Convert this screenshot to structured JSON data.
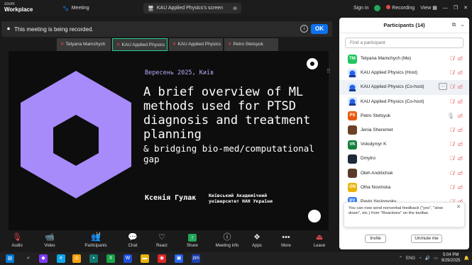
{
  "titlebar": {
    "brand_line1": "zoom",
    "brand_line2": "Workplace",
    "meeting_tab": "Meeting",
    "share_tab": "KAU Applied Physics's screen",
    "signin": "Sign in",
    "recording": "Recording",
    "view": "View"
  },
  "banner": {
    "text": "This meeting is being recorded.",
    "ok": "OK"
  },
  "thumbnails": [
    {
      "name": "Tetyana Mamchych"
    },
    {
      "name": "KAU Applied Physics"
    },
    {
      "name": "KAU Applied Physics"
    },
    {
      "name": "Petro Stetsyuk"
    }
  ],
  "slide": {
    "date": "Вересень 2025, Київ",
    "title": "A brief overview of ML methods used for PTSD diagnosis and treatment planning",
    "subtitle": "& bridging bio-med/computational gap",
    "author": "Ксенія Гулак",
    "institution_line1": "Київський Академічний",
    "institution_line2": "університет НАН України",
    "accent_color": "#a78bfa"
  },
  "toolbar": {
    "audio": "Audio",
    "video": "Video",
    "participants": "Participants",
    "participants_count": "14",
    "chat": "Chat",
    "react": "React",
    "share": "Share",
    "meeting_info": "Meeting info",
    "apps": "Apps",
    "more": "More",
    "leave": "Leave"
  },
  "panel": {
    "title": "Participants (14)",
    "search_placeholder": "Find a participant",
    "participants": [
      {
        "initials": "TM",
        "name": "Tetyana Mamchych (Me)",
        "color": "#22c55e"
      },
      {
        "initials": "",
        "name": "KAU Applied Physics (Host)",
        "color": "#dbeafe"
      },
      {
        "initials": "",
        "name": "KAU Applied Physics (Co-host)",
        "color": "#dbeafe"
      },
      {
        "initials": "",
        "name": "KAU Applied Physics (Co-host)",
        "color": "#dbeafe"
      },
      {
        "initials": "PS",
        "name": "Petro Stetsyuk",
        "color": "#ea580c"
      },
      {
        "initials": "",
        "name": "Jenia Sheremet",
        "color": "#6b4226"
      },
      {
        "initials": "VK",
        "name": "Volodymyr K",
        "color": "#15803d"
      },
      {
        "initials": "",
        "name": "Dmytro",
        "color": "#1f2937"
      },
      {
        "initials": "",
        "name": "Oleh Andriichuk",
        "color": "#5b3a29"
      },
      {
        "initials": "ON",
        "name": "Olha Novinska",
        "color": "#eab308"
      },
      {
        "initials": "PY",
        "name": "Pavlo Yasinovsky",
        "color": "#3b82f6"
      }
    ],
    "notice": "You can now send nonverbal feedback (\"yes\", \"slow down\", etc.) from \"Reactions\" on the toolbar.",
    "invite": "Invite",
    "unmute_me": "Unmute me"
  },
  "taskbar": {
    "language": "ENG",
    "time": "5:04 PM",
    "date": "9/29/2025"
  }
}
